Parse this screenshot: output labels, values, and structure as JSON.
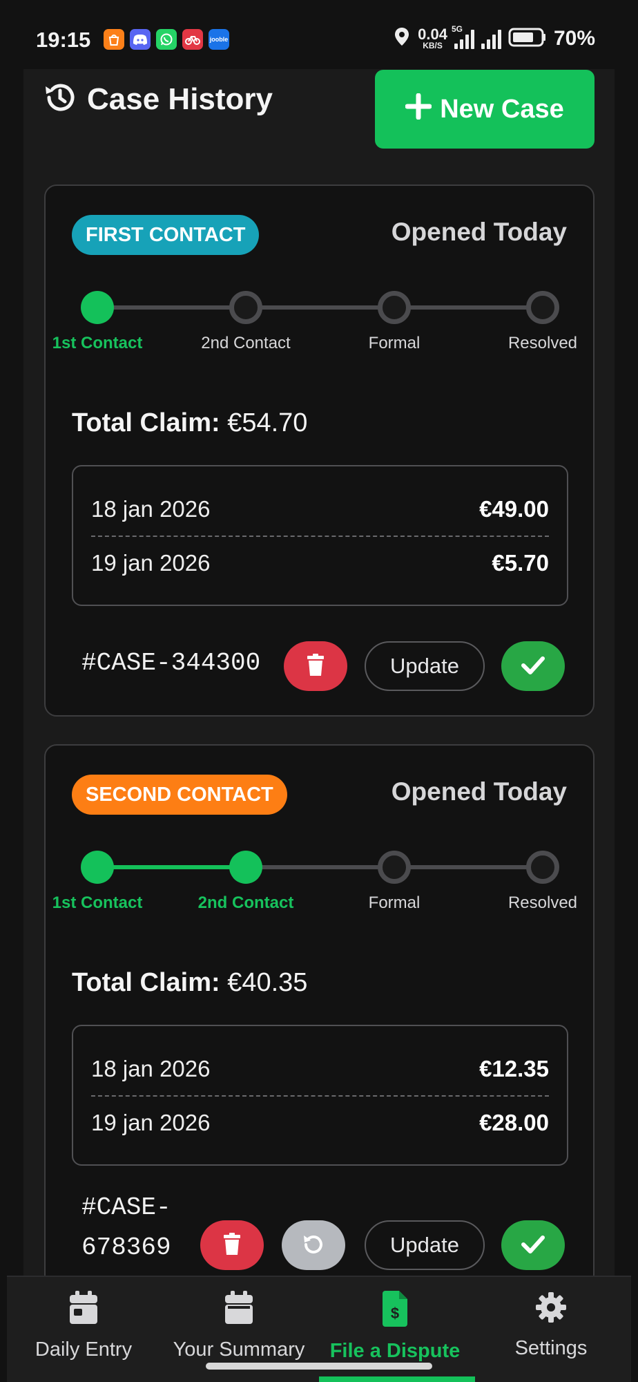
{
  "status_bar": {
    "time": "19:15",
    "net_speed_value": "0.04",
    "net_speed_unit": "KB/S",
    "network": "5G",
    "battery": "70%",
    "app_icons": [
      "swiggy-icon",
      "discord-icon",
      "whatsapp-icon",
      "bike-icon",
      "jooble-icon"
    ],
    "jooble_text": "jooble"
  },
  "header": {
    "icon": "history-icon",
    "title": "Case History",
    "new_case_label": "New Case"
  },
  "steps": [
    "1st Contact",
    "2nd Contact",
    "Formal",
    "Resolved"
  ],
  "cases": [
    {
      "badge": "FIRST CONTACT",
      "badge_color": "#17a2b8",
      "opened": "Opened Today",
      "completed_steps": 1,
      "total_label": "Total Claim:",
      "total_value": "€54.70",
      "items": [
        {
          "date": "18 jan 2026",
          "amount": "€49.00"
        },
        {
          "date": "19 jan 2026",
          "amount": "€5.70"
        }
      ],
      "case_id": "#CASE-344300",
      "update_label": "Update"
    },
    {
      "badge": "SECOND CONTACT",
      "badge_color": "#fd7e14",
      "opened": "Opened Today",
      "completed_steps": 2,
      "total_label": "Total Claim:",
      "total_value": "€40.35",
      "items": [
        {
          "date": "18 jan 2026",
          "amount": "€12.35"
        },
        {
          "date": "19 jan 2026",
          "amount": "€28.00"
        }
      ],
      "case_id_line1": "#CASE-",
      "case_id_line2": "678369",
      "update_label": "Update"
    }
  ],
  "nav": [
    {
      "label": "Daily Entry",
      "icon": "calendar-day-icon",
      "active": false
    },
    {
      "label": "Your Summary",
      "icon": "calendar-icon",
      "active": false
    },
    {
      "label": "File a Dispute",
      "icon": "invoice-dollar-icon",
      "active": true
    },
    {
      "label": "Settings",
      "icon": "gear-icon",
      "active": false
    }
  ],
  "colors": {
    "accent": "#14c15a",
    "danger": "#dc3545",
    "success": "#28a745",
    "background": "#121212"
  }
}
